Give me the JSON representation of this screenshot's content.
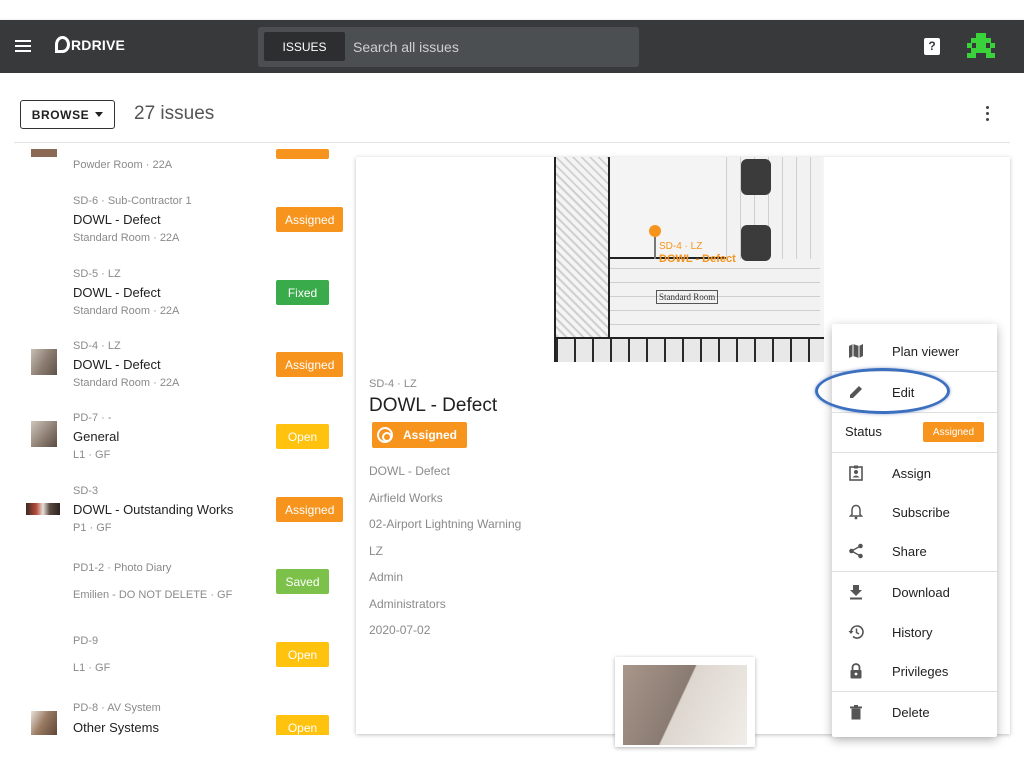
{
  "app": {
    "logo_text": "RDRIVE"
  },
  "search": {
    "tab_label": "ISSUES",
    "placeholder": "Search all issues"
  },
  "help": {
    "glyph": "?"
  },
  "toolbar": {
    "browse_label": "BROWSE",
    "issue_count": "27 issues"
  },
  "issues": [
    {
      "meta": "",
      "title": "",
      "sub": "Powder Room · 22A",
      "status": "",
      "status_color": "#f6941d",
      "has_thumb": true
    },
    {
      "meta": "SD-6 · Sub-Contractor 1",
      "title": "DOWL - Defect",
      "sub": "Standard Room · 22A",
      "status": "Assigned",
      "status_color": "#f6941d",
      "has_thumb": false
    },
    {
      "meta": "SD-5 · LZ",
      "title": "DOWL - Defect",
      "sub": "Standard Room · 22A",
      "status": "Fixed",
      "status_color": "#3aab4b",
      "has_thumb": false
    },
    {
      "meta": "SD-4 · LZ",
      "title": "DOWL - Defect",
      "sub": "Standard Room · 22A",
      "status": "Assigned",
      "status_color": "#f6941d",
      "has_thumb": true
    },
    {
      "meta": "PD-7 · -",
      "title": "General",
      "sub": "L1 · GF",
      "status": "Open",
      "status_color": "#ffc20e",
      "has_thumb": true
    },
    {
      "meta": "SD-3",
      "title": "DOWL - Outstanding Works",
      "sub": "P1 · GF",
      "status": "Assigned",
      "status_color": "#f6941d",
      "has_thumb": true
    },
    {
      "meta": "PD1-2 · Photo Diary",
      "title": "",
      "sub": "Emilien - DO NOT DELETE · GF",
      "status": "Saved",
      "status_color": "#7cc24a",
      "has_thumb": false
    },
    {
      "meta": "PD-9",
      "title": "",
      "sub": "L1 · GF",
      "status": "Open",
      "status_color": "#ffc20e",
      "has_thumb": false
    },
    {
      "meta": "PD-8 · AV System",
      "title": "Other Systems",
      "sub": "",
      "status": "Open",
      "status_color": "#ffc20e",
      "has_thumb": true
    }
  ],
  "detail": {
    "plan_pin_meta": "SD-4 · LZ",
    "plan_pin_title": "DOWL - Defect",
    "plan_room_label": "Standard Room",
    "meta": "SD-4 · LZ",
    "title": "DOWL - Defect",
    "status": "Assigned",
    "fields": [
      "DOWL - Defect",
      "Airfield Works",
      "02-Airport Lightning Warning",
      "LZ",
      "Admin",
      "Administrators",
      "2020-07-02"
    ]
  },
  "menu": {
    "plan_viewer": "Plan viewer",
    "edit": "Edit",
    "status_label": "Status",
    "status_value": "Assigned",
    "assign": "Assign",
    "subscribe": "Subscribe",
    "share": "Share",
    "download": "Download",
    "history": "History",
    "privileges": "Privileges",
    "delete": "Delete"
  },
  "colors": {
    "topbar": "#37393b",
    "assigned": "#f6941d",
    "fixed": "#3aab4b",
    "open": "#ffc20e",
    "saved": "#7cc24a",
    "highlight": "#3b6fbf"
  }
}
